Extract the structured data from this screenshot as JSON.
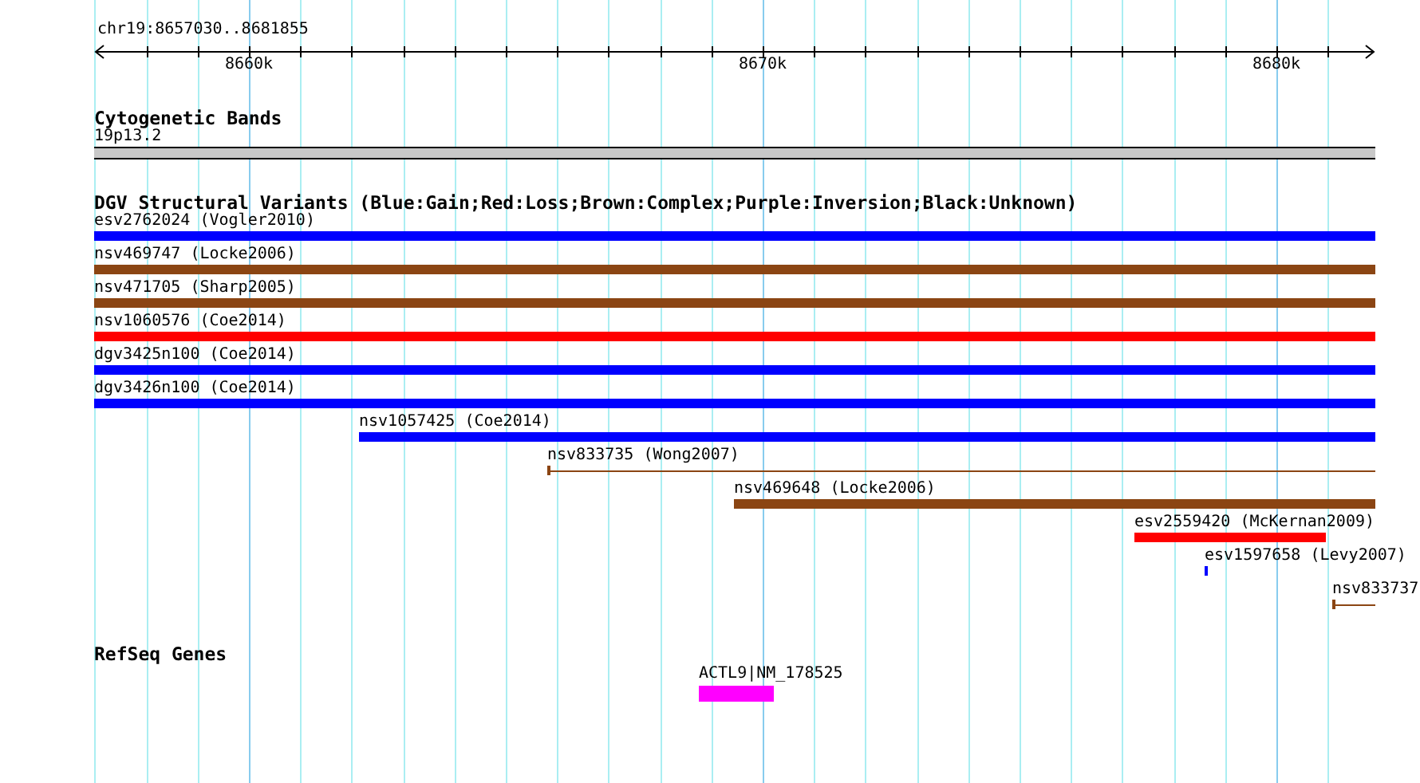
{
  "ruler": {
    "range": "chr19:8657030..8681855",
    "ticks": [
      "8660k",
      "8670k",
      "8680k"
    ]
  },
  "cytogenetic_bands": {
    "title": "Cytogenetic Bands",
    "band": "19p13.2"
  },
  "variants": {
    "title": "DGV Structural Variants (Blue:Gain;Red:Loss;Brown:Complex;Purple:Inversion;Black:Unknown)",
    "items": [
      {
        "label": "esv2762024 (Vogler2010)",
        "kind": "bar",
        "color": "#0000ff"
      },
      {
        "label": "nsv469747 (Locke2006)",
        "kind": "bar",
        "color": "#8b4513"
      },
      {
        "label": "nsv471705 (Sharp2005)",
        "kind": "bar",
        "color": "#8b4513"
      },
      {
        "label": "nsv1060576 (Coe2014)",
        "kind": "bar",
        "color": "#ff0000"
      },
      {
        "label": "dgv3425n100 (Coe2014)",
        "kind": "bar",
        "color": "#0000ff"
      },
      {
        "label": "dgv3426n100 (Coe2014)",
        "kind": "bar",
        "color": "#0000ff"
      },
      {
        "label": "nsv1057425 (Coe2014)",
        "kind": "bar",
        "color": "#0000ff"
      },
      {
        "label": "nsv833735 (Wong2007)",
        "kind": "line",
        "color": "#8b4513"
      },
      {
        "label": "nsv469648 (Locke2006)",
        "kind": "bar",
        "color": "#8b4513"
      },
      {
        "label": "esv2559420 (McKernan2009)",
        "kind": "bar",
        "color": "#ff0000"
      },
      {
        "label": "esv1597658 (Levy2007)",
        "kind": "tick",
        "color": "#0000ff"
      },
      {
        "label": "nsv833737",
        "kind": "line",
        "color": "#8b4513"
      }
    ]
  },
  "refseq_genes": {
    "title": "RefSeq Genes",
    "genes": [
      {
        "label": "ACTL9|NM_178525"
      }
    ]
  }
}
